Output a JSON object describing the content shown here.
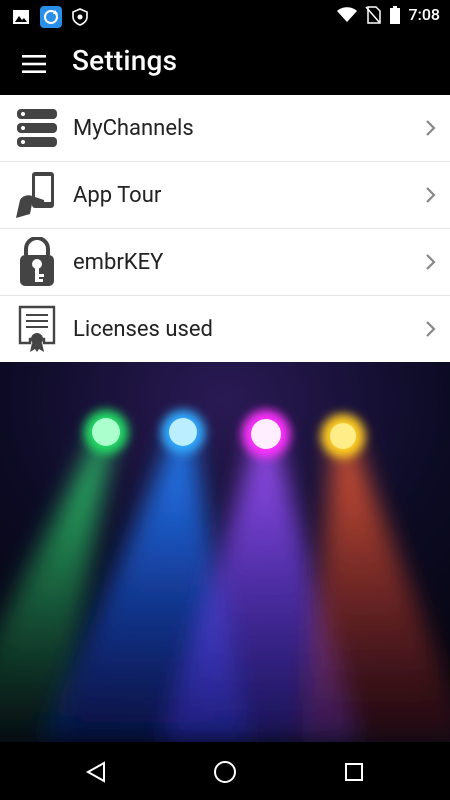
{
  "status_bar": {
    "time": "7:08",
    "left_icons": [
      "image-icon",
      "sync-app-icon",
      "shield-icon"
    ],
    "right_icons": [
      "wifi-icon",
      "no-sim-icon",
      "battery-icon"
    ]
  },
  "app_bar": {
    "title": "Settings",
    "menu_icon": "hamburger-menu-icon"
  },
  "settings_items": [
    {
      "label": "MyChannels",
      "icon": "server-stack-icon"
    },
    {
      "label": "App Tour",
      "icon": "hand-phone-icon"
    },
    {
      "label": "embrKEY",
      "icon": "key-lock-icon"
    },
    {
      "label": "Licenses used",
      "icon": "certificate-icon"
    }
  ],
  "hero": {
    "lights": [
      {
        "color": "#22dd66"
      },
      {
        "color": "#33aaff"
      },
      {
        "color": "#ff33ff"
      },
      {
        "color": "#ffcc22"
      }
    ]
  },
  "nav_bar": {
    "buttons": [
      "back-icon",
      "home-icon",
      "recents-icon"
    ]
  }
}
